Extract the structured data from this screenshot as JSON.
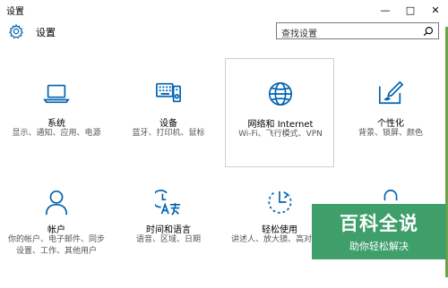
{
  "window": {
    "title": "设置",
    "minimize": "—",
    "maximize": "□",
    "close": "✕"
  },
  "header": {
    "title": "设置",
    "gear_icon": "gear-icon"
  },
  "search": {
    "placeholder": "查找设置",
    "icon": "search-icon"
  },
  "tiles": [
    {
      "name": "系统",
      "desc": "显示、通知、应用、电源",
      "icon": "laptop-icon"
    },
    {
      "name": "设备",
      "desc": "蓝牙、打印机、鼠标",
      "icon": "keyboard-device-icon"
    },
    {
      "name": "网络和 Internet",
      "desc": "Wi-Fi、飞行模式、VPN",
      "icon": "globe-icon"
    },
    {
      "name": "个性化",
      "desc": "背景、锁屏、颜色",
      "icon": "paint-icon"
    },
    {
      "name": "帐户",
      "desc": "你的帐户、电子邮件、同步设置、工作、其他用户",
      "icon": "person-icon"
    },
    {
      "name": "时间和语言",
      "desc": "语音、区域、日期",
      "icon": "time-language-icon"
    },
    {
      "name": "轻松使用",
      "desc": "讲述人、放大镜、高对比度",
      "icon": "ease-of-access-icon"
    },
    {
      "name": "",
      "desc": "",
      "icon": "privacy-icon"
    }
  ],
  "watermark": {
    "title": "百科全说",
    "subtitle": "助你轻松解决"
  },
  "colors": {
    "accent": "#0063b1",
    "watermark_bg": "#3f9f6b"
  }
}
